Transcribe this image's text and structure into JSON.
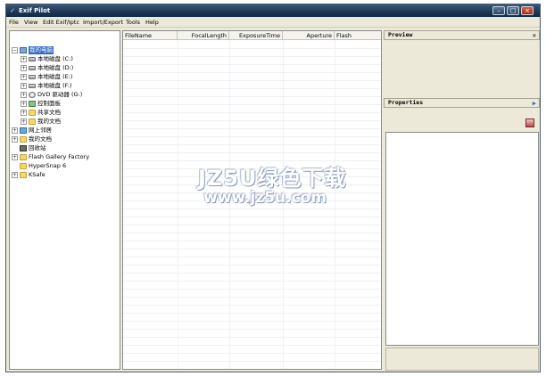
{
  "window": {
    "title": "Exif Pilot",
    "controls": {
      "minimize": "–",
      "maximize": "□",
      "close": "×"
    }
  },
  "menubar": {
    "items": [
      {
        "label": "File"
      },
      {
        "label": "View"
      },
      {
        "label": "Edit Exif/Iptc"
      },
      {
        "label": "Import/Export"
      },
      {
        "label": "Tools"
      },
      {
        "label": "Help"
      }
    ]
  },
  "tree": {
    "nodes": [
      {
        "label": "我的电脑",
        "icon": "computer-icon",
        "expander": "−",
        "selected": true
      },
      {
        "label": "本地磁盘 (C:)",
        "icon": "drive-icon",
        "expander": "+"
      },
      {
        "label": "本地磁盘 (D:)",
        "icon": "drive-icon",
        "expander": "+"
      },
      {
        "label": "本地磁盘 (E:)",
        "icon": "drive-icon",
        "expander": "+"
      },
      {
        "label": "本地磁盘 (F:)",
        "icon": "drive-icon",
        "expander": "+"
      },
      {
        "label": "DVD 驱动器 (G:)",
        "icon": "dvd-icon",
        "expander": "+"
      },
      {
        "label": "控制面板",
        "icon": "control-panel-icon",
        "expander": "+"
      },
      {
        "label": "共享文档",
        "icon": "folder-icon",
        "expander": "+"
      },
      {
        "label": "我的文档",
        "icon": "folder-icon",
        "expander": "+"
      },
      {
        "label": "网上邻居",
        "icon": "network-icon",
        "expander": "+"
      },
      {
        "label": "我的文档",
        "icon": "folder-icon",
        "expander": "+"
      },
      {
        "label": "回收站",
        "icon": "recycle-bin-icon",
        "expander": ""
      },
      {
        "label": "Flash Gallery Factory",
        "icon": "folder-icon",
        "expander": "+"
      },
      {
        "label": "HyperSnap 6",
        "icon": "folder-icon",
        "expander": ""
      },
      {
        "label": "KSafe",
        "icon": "folder-icon",
        "expander": "+"
      }
    ]
  },
  "grid": {
    "columns": [
      {
        "label": "FileName"
      },
      {
        "label": "FocalLength"
      },
      {
        "label": "ExposureTime"
      },
      {
        "label": "Aperture"
      },
      {
        "label": "Flash"
      }
    ]
  },
  "panels": {
    "preview": {
      "label": "Preview",
      "close": "×"
    },
    "properties": {
      "label": "Properties"
    }
  },
  "watermark": {
    "main": "JZ5U绿色下载",
    "sub": "www.jz5u.com"
  },
  "colors": {
    "titlebar": "#1e3a58",
    "selection": "#316ac5",
    "window_bg": "#ece9d8"
  }
}
